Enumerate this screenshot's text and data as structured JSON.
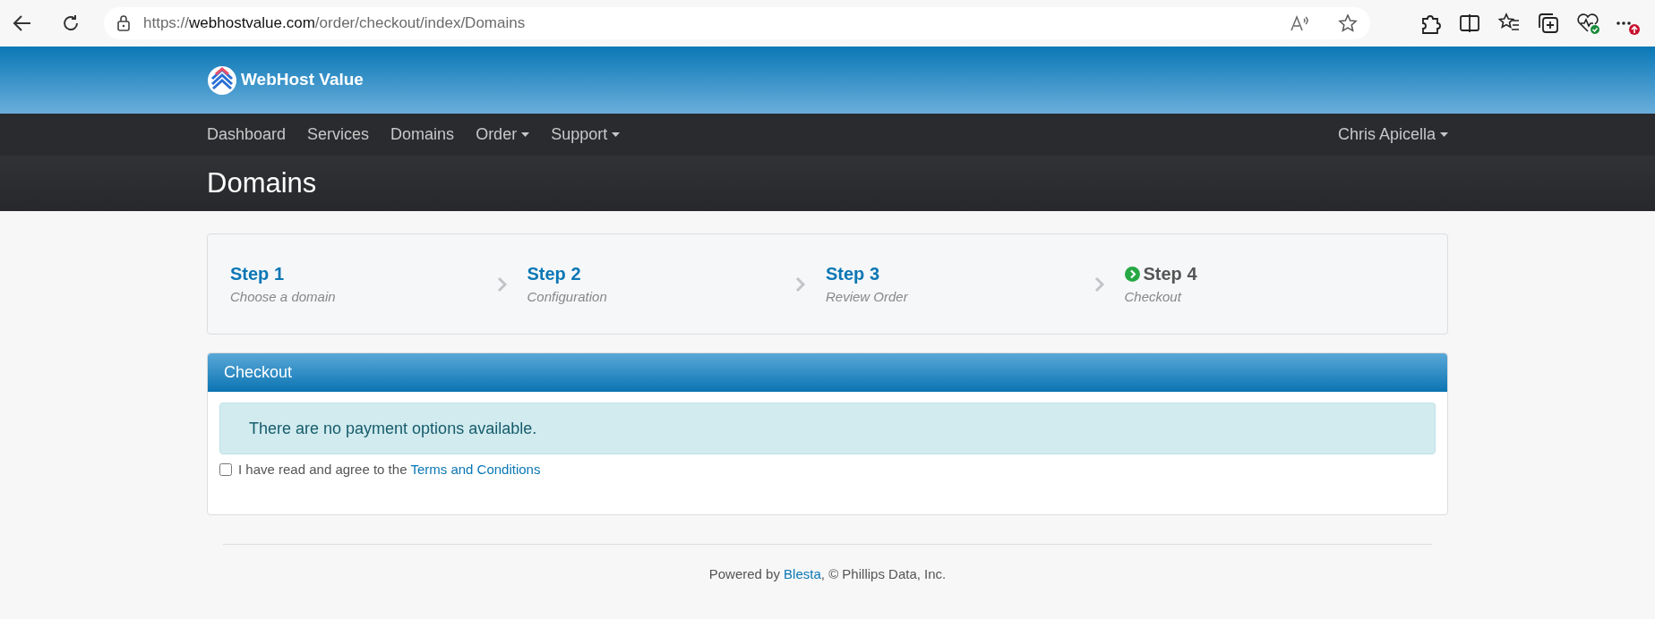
{
  "browser": {
    "url": {
      "scheme": "https://",
      "host": "webhostvalue.com",
      "path": "/order/checkout/index/Domains"
    }
  },
  "header": {
    "brand": "WebHost Value"
  },
  "nav": {
    "items": [
      {
        "label": "Dashboard",
        "dropdown": false
      },
      {
        "label": "Services",
        "dropdown": false
      },
      {
        "label": "Domains",
        "dropdown": false
      },
      {
        "label": "Order",
        "dropdown": true
      },
      {
        "label": "Support",
        "dropdown": true
      }
    ],
    "user": {
      "label": "Chris Apicella",
      "dropdown": true
    }
  },
  "page_title": "Domains",
  "steps": [
    {
      "title": "Step 1",
      "subtitle": "Choose a domain",
      "selected": false
    },
    {
      "title": "Step 2",
      "subtitle": "Configuration",
      "selected": false
    },
    {
      "title": "Step 3",
      "subtitle": "Review Order",
      "selected": false
    },
    {
      "title": "Step 4",
      "subtitle": "Checkout",
      "selected": true
    }
  ],
  "checkout": {
    "title": "Checkout",
    "alert": "There are no payment options available.",
    "terms": {
      "checked": false,
      "label": "I have read and agree to the ",
      "link": "Terms and Conditions"
    }
  },
  "footer": {
    "before": "Powered by ",
    "link": "Blesta",
    "after": ", © Phillips Data, Inc."
  }
}
